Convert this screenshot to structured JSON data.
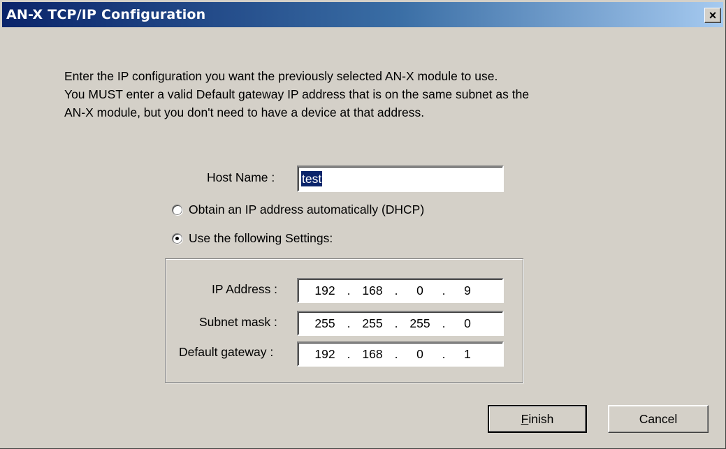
{
  "window": {
    "title": "AN-X TCP/IP Configuration",
    "close_glyph": "×",
    "close_icon": "close-icon"
  },
  "intro": {
    "line1": "Enter the IP configuration you want the previously selected AN-X module to use.",
    "line2": "You MUST enter a valid Default gateway IP address that is on the same subnet as the",
    "line3": "AN-X module, but you don't need to have a device at that address."
  },
  "host": {
    "label": "Host Name :",
    "value": "test"
  },
  "options": {
    "dhcp_label": "Obtain an IP address automatically (DHCP)",
    "dhcp_selected": false,
    "static_label": "Use the following Settings:",
    "static_selected": true
  },
  "settings": {
    "ip": {
      "label": "IP Address :",
      "octets": [
        "192",
        "168",
        "0",
        "9"
      ]
    },
    "subnet": {
      "label": "Subnet mask :",
      "octets": [
        "255",
        "255",
        "255",
        "0"
      ]
    },
    "gateway": {
      "label": "Default gateway :",
      "octets": [
        "192",
        "168",
        "0",
        "1"
      ]
    },
    "dot": "."
  },
  "buttons": {
    "finish_underlined": "F",
    "finish_rest": "inish",
    "cancel": "Cancel"
  }
}
